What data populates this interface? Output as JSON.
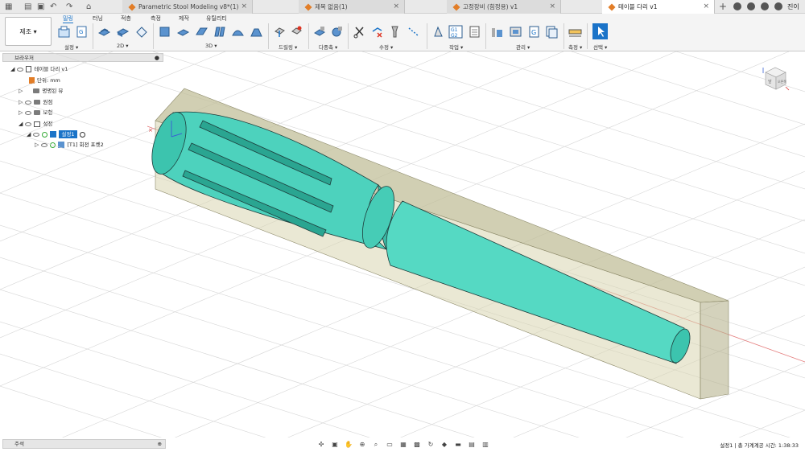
{
  "window": {
    "user_initial": "진이",
    "tabs": [
      {
        "label": "Parametric Stool Modeling v8*(1)",
        "active": false
      },
      {
        "label": "제목 없음(1)",
        "active": false
      },
      {
        "label": "고정장비 (힘정용) v1",
        "active": false
      },
      {
        "label": "테이블 다리 v1",
        "active": true
      }
    ]
  },
  "ribbon": {
    "workspace_button": "제조 ▾",
    "tabs": [
      "밀링",
      "터닝",
      "적층",
      "측정",
      "제작",
      "유틸리티"
    ],
    "active_tab": "밀링",
    "groups": [
      "설정 ▾",
      "2D ▾",
      "3D ▾",
      "드릴링 ▾",
      "다중축 ▾",
      "수정 ▾",
      "작업 ▾",
      "관리 ▾",
      "측정 ▾",
      "선택 ▾"
    ],
    "g1g2": [
      "G1",
      "G2"
    ]
  },
  "browser": {
    "title": "브라우저",
    "root": "테이블 다리 v1",
    "items": [
      {
        "label": "단위: mm"
      },
      {
        "label": "명명된 뷰"
      },
      {
        "label": "원점"
      },
      {
        "label": "모형"
      },
      {
        "label": "설정"
      },
      {
        "label": "설정1"
      },
      {
        "label": "[T1] 회전 포켓2"
      }
    ]
  },
  "comments": {
    "label": "주석"
  },
  "status": {
    "text": "설정1 | 총 가계계공 시간: 1:38:33"
  },
  "viewcube": {
    "front": "앞",
    "right": "오른쪽"
  },
  "colors": {
    "accent": "#1a73c8",
    "part": "#4fd8c0",
    "stock": "#c8c49a",
    "orange": "#e27d27"
  }
}
